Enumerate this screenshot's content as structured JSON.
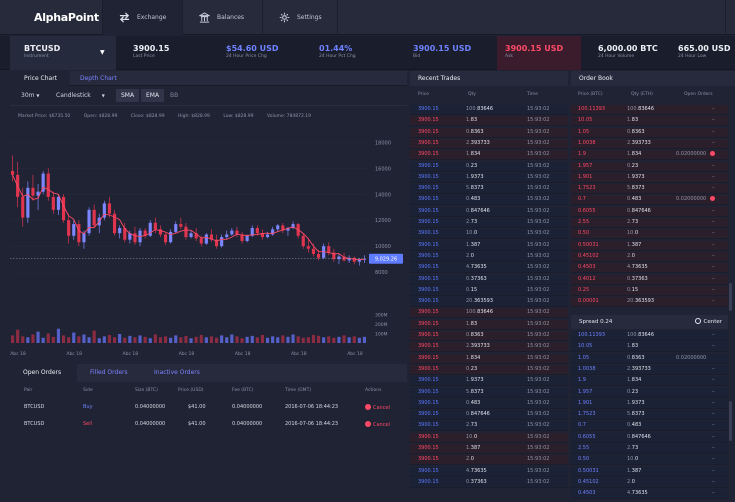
{
  "app": {
    "logo": "AlphaPoint"
  },
  "nav": {
    "tabs": [
      {
        "label": "Exchange",
        "icon": "exchange-icon",
        "active": true
      },
      {
        "label": "Balances",
        "icon": "bank-icon",
        "active": false
      },
      {
        "label": "Settings",
        "icon": "gear-icon",
        "active": false
      }
    ]
  },
  "ticker": {
    "instrument": {
      "value": "BTCUSD",
      "label": "Instrument"
    },
    "stats": [
      {
        "value": "3900.15",
        "label": "Last Price",
        "style": "plain"
      },
      {
        "value": "$54.60 USD",
        "label": "24 Hour Price Chg",
        "style": "blue"
      },
      {
        "value": "01.44%",
        "label": "24 Hour Pct Chg",
        "style": "blue"
      },
      {
        "value": "3900.15 USD",
        "label": "Bid",
        "style": "blue"
      },
      {
        "value": "3900.15 USD",
        "label": "Ask",
        "style": "red"
      },
      {
        "value": "6,000.00 BTC",
        "label": "24 Hour Volume",
        "style": "plain"
      },
      {
        "value": "665.00 USD",
        "label": "24 Hour Low",
        "style": "plain"
      }
    ]
  },
  "chart_panel": {
    "tabs": [
      "Price Chart",
      "Depth Chart"
    ],
    "interval": "30m",
    "chart_style": "Candlestick",
    "indicators": [
      "SMA",
      "EMA",
      "BB"
    ],
    "ohlc": {
      "market": "Market Price: $6735.50",
      "open": "Open: $828.99",
      "close": "Close: $828.99",
      "high": "High: $828.99",
      "low": "Low: $828.99",
      "volume": "Volume: 784872.19"
    }
  },
  "chart_data": {
    "type": "candlestick",
    "price_axis": {
      "ticks": [
        "18000",
        "16000",
        "14000",
        "12000",
        "10000",
        "8000"
      ],
      "values": [
        18000,
        16000,
        14000,
        12000,
        10000,
        8000
      ],
      "range": [
        6000,
        19500
      ]
    },
    "volume_axis": {
      "ticks": [
        "300M",
        "200M",
        "100M"
      ],
      "values": [
        300,
        200,
        100
      ],
      "range": [
        0,
        400
      ]
    },
    "x_tick_labels": [
      "Abc 18",
      "Abc 18",
      "Abc 18",
      "Abc 18",
      "Abc 18",
      "Abc 18",
      "Abc 18"
    ],
    "current_price": {
      "label": "9,029.26",
      "value": 9029.26
    },
    "candles": [
      [
        15800,
        17000,
        15000,
        15500
      ],
      [
        15500,
        16500,
        13000,
        13800
      ],
      [
        13800,
        14500,
        11500,
        12200
      ],
      [
        12200,
        15000,
        11800,
        14500
      ],
      [
        14500,
        15500,
        13500,
        13900
      ],
      [
        13900,
        14800,
        12800,
        14200
      ],
      [
        14200,
        15800,
        14000,
        15600
      ],
      [
        15600,
        16000,
        13500,
        13800
      ],
      [
        13800,
        14200,
        12500,
        12800
      ],
      [
        12800,
        14000,
        12400,
        13800
      ],
      [
        13800,
        14000,
        11800,
        12000
      ],
      [
        12000,
        12500,
        10200,
        10800
      ],
      [
        10800,
        12000,
        10500,
        11700
      ],
      [
        11700,
        12000,
        10000,
        10300
      ],
      [
        10300,
        11200,
        9800,
        11000
      ],
      [
        11000,
        13000,
        10800,
        12800
      ],
      [
        12800,
        13200,
        11400,
        11600
      ],
      [
        11600,
        12500,
        11000,
        12200
      ],
      [
        12200,
        13500,
        12000,
        13300
      ],
      [
        13300,
        13800,
        12200,
        12500
      ],
      [
        12500,
        12800,
        10800,
        11000
      ],
      [
        11000,
        11600,
        10600,
        11400
      ],
      [
        11400,
        11800,
        10300,
        10500
      ],
      [
        10500,
        11200,
        10200,
        11000
      ],
      [
        11000,
        11500,
        10100,
        10300
      ],
      [
        10300,
        11400,
        10000,
        11200
      ],
      [
        11200,
        11400,
        10600,
        10800
      ],
      [
        10800,
        12000,
        10700,
        11800
      ],
      [
        11800,
        12200,
        11000,
        11300
      ],
      [
        11300,
        11600,
        10700,
        10900
      ],
      [
        10900,
        11000,
        10100,
        10300
      ],
      [
        10300,
        11300,
        10200,
        11100
      ],
      [
        11100,
        11900,
        11000,
        11700
      ],
      [
        11700,
        12200,
        11300,
        11500
      ],
      [
        11500,
        11800,
        10500,
        10700
      ],
      [
        10700,
        11200,
        10600,
        11000
      ],
      [
        11000,
        11400,
        10400,
        10600
      ],
      [
        10600,
        10800,
        10000,
        10200
      ],
      [
        10200,
        11000,
        10100,
        10900
      ],
      [
        10900,
        11300,
        10300,
        10500
      ],
      [
        10500,
        10900,
        9800,
        10000
      ],
      [
        10000,
        10900,
        9900,
        10700
      ],
      [
        10700,
        11200,
        10500,
        10900
      ],
      [
        10900,
        11400,
        10800,
        11200
      ],
      [
        11200,
        11500,
        10700,
        10900
      ],
      [
        10900,
        11100,
        10200,
        10400
      ],
      [
        10400,
        10900,
        10300,
        10800
      ],
      [
        10800,
        11600,
        10700,
        11400
      ],
      [
        11400,
        11600,
        10800,
        11000
      ],
      [
        11000,
        11300,
        10500,
        10700
      ],
      [
        10700,
        11100,
        10600,
        10900
      ],
      [
        10900,
        11500,
        10800,
        11300
      ],
      [
        11300,
        11700,
        11100,
        11600
      ],
      [
        11600,
        11800,
        11000,
        11200
      ],
      [
        11200,
        11500,
        10800,
        11400
      ],
      [
        11400,
        11900,
        11300,
        11700
      ],
      [
        11700,
        11800,
        10600,
        10800
      ],
      [
        10800,
        11000,
        9800,
        10000
      ],
      [
        10000,
        10500,
        9500,
        9800
      ],
      [
        9800,
        10200,
        9200,
        9400
      ],
      [
        9400,
        9700,
        8900,
        9100
      ],
      [
        9100,
        10200,
        9000,
        10000
      ],
      [
        10000,
        10300,
        9300,
        9500
      ],
      [
        9500,
        9800,
        8800,
        9000
      ],
      [
        9000,
        9400,
        8600,
        9200
      ],
      [
        9200,
        9500,
        8800,
        8900
      ],
      [
        8900,
        9300,
        8700,
        9100
      ],
      [
        9100,
        9200,
        8600,
        8800
      ],
      [
        8800,
        9100,
        8500,
        9000
      ],
      [
        9000,
        9300,
        8700,
        9029
      ]
    ],
    "volumes": [
      80,
      140,
      70,
      60,
      90,
      120,
      55,
      100,
      65,
      150,
      80,
      60,
      110,
      70,
      90,
      60,
      130,
      50,
      70,
      85,
      60,
      95,
      55,
      75,
      60,
      80,
      65,
      50,
      90,
      60,
      70,
      55,
      80,
      60,
      75,
      50,
      65,
      85,
      60,
      70,
      55,
      80,
      60,
      90,
      70,
      50,
      65,
      75,
      60,
      85,
      55,
      70,
      60,
      80,
      65,
      90,
      70,
      55,
      60,
      85,
      75,
      60,
      70,
      55,
      65,
      80,
      60,
      70,
      55,
      65
    ]
  },
  "orders": {
    "tabs": [
      "Open Orders",
      "Filled Orders",
      "Inactive Orders"
    ],
    "columns": [
      "Pair",
      "Side",
      "Size (BTC)",
      "Price (USD)",
      "Fee (BTC)",
      "Time (GMT)",
      "Actions"
    ],
    "rows": [
      {
        "pair": "BTCUSD",
        "side": "Buy",
        "size": "0.04000000",
        "price": "$41.00",
        "fee": "0.04000000",
        "time": "2016-07-06 18:44:23",
        "action": "Cancel"
      },
      {
        "pair": "BTCUSD",
        "side": "Sell",
        "size": "0.04000000",
        "price": "$41.00",
        "fee": "0.04000000",
        "time": "2016-07-06 18:44:23",
        "action": "Cancel"
      }
    ]
  },
  "trades": {
    "title": "Recent Trades",
    "columns": [
      "Price",
      "Qty",
      "Time"
    ],
    "rows": [
      {
        "p": "3900.15",
        "s": "b",
        "q1": "100.",
        "q2": "83646",
        "t": "15:93:02"
      },
      {
        "p": "3900.15",
        "s": "s",
        "q1": "1.",
        "q2": "83",
        "t": "15:93:02"
      },
      {
        "p": "3900.15",
        "s": "s",
        "q1": "0.",
        "q2": "8363",
        "t": "15:93:02"
      },
      {
        "p": "3900.15",
        "s": "s",
        "q1": "2.",
        "q2": "393733",
        "t": "15:93:02"
      },
      {
        "p": "3900.15",
        "s": "s",
        "q1": "1.",
        "q2": "834",
        "t": "15:93:02"
      },
      {
        "p": "3900.15",
        "s": "b",
        "q1": "0.",
        "q2": "23",
        "t": "15:93:02"
      },
      {
        "p": "3900.15",
        "s": "b",
        "q1": "1.",
        "q2": "9373",
        "t": "15:93:02"
      },
      {
        "p": "3900.15",
        "s": "b",
        "q1": "5.",
        "q2": "8373",
        "t": "15:93:02"
      },
      {
        "p": "3900.15",
        "s": "b",
        "q1": "0.",
        "q2": "483",
        "t": "15:93:02"
      },
      {
        "p": "3900.15",
        "s": "b",
        "q1": "0.",
        "q2": "847646",
        "t": "15:93:02"
      },
      {
        "p": "3900.15",
        "s": "b",
        "q1": "2.",
        "q2": "73",
        "t": "15:93:02"
      },
      {
        "p": "3900.15",
        "s": "b",
        "q1": "10.",
        "q2": "0",
        "t": "15:93:02"
      },
      {
        "p": "3900.15",
        "s": "b",
        "q1": "1.",
        "q2": "387",
        "t": "15:93:02"
      },
      {
        "p": "3900.15",
        "s": "b",
        "q1": "2.",
        "q2": "0",
        "t": "15:93:02"
      },
      {
        "p": "3900.15",
        "s": "b",
        "q1": "4.",
        "q2": "73635",
        "t": "15:93:02"
      },
      {
        "p": "3900.15",
        "s": "b",
        "q1": "0.",
        "q2": "37363",
        "t": "15:93:02"
      },
      {
        "p": "3900.15",
        "s": "b",
        "q1": "0.",
        "q2": "15",
        "t": "15:93:02"
      },
      {
        "p": "3900.15",
        "s": "b",
        "q1": "20.",
        "q2": "363593",
        "t": "15:93:02"
      },
      {
        "p": "3900.15",
        "s": "s",
        "q1": "100.",
        "q2": "83646",
        "t": "15:93:02"
      },
      {
        "p": "3900.15",
        "s": "s",
        "q1": "1.",
        "q2": "83",
        "t": "15:93:02"
      },
      {
        "p": "3900.15",
        "s": "s",
        "q1": "0.",
        "q2": "8363",
        "t": "15:93:02"
      },
      {
        "p": "3900.15",
        "s": "s",
        "q1": "2.",
        "q2": "393733",
        "t": "15:93:02"
      },
      {
        "p": "3900.15",
        "s": "s",
        "q1": "1.",
        "q2": "834",
        "t": "15:93:02"
      },
      {
        "p": "3900.15",
        "s": "s",
        "q1": "0.",
        "q2": "23",
        "t": "15:93:02"
      },
      {
        "p": "3900.15",
        "s": "b",
        "q1": "1.",
        "q2": "9373",
        "t": "15:93:02"
      },
      {
        "p": "3900.15",
        "s": "b",
        "q1": "5.",
        "q2": "8373",
        "t": "15:93:02"
      },
      {
        "p": "3900.15",
        "s": "b",
        "q1": "0.",
        "q2": "483",
        "t": "15:93:02"
      },
      {
        "p": "3900.15",
        "s": "b",
        "q1": "0.",
        "q2": "847646",
        "t": "15:93:02"
      },
      {
        "p": "3900.15",
        "s": "b",
        "q1": "2.",
        "q2": "73",
        "t": "15:93:02"
      },
      {
        "p": "3900.15",
        "s": "s",
        "q1": "10.",
        "q2": "0",
        "t": "15:93:02"
      },
      {
        "p": "3900.15",
        "s": "s",
        "q1": "1.",
        "q2": "387",
        "t": "15:93:02"
      },
      {
        "p": "3900.15",
        "s": "s",
        "q1": "2.",
        "q2": "0",
        "t": "15:93:02"
      },
      {
        "p": "3900.15",
        "s": "b",
        "q1": "4.",
        "q2": "73635",
        "t": "15:93:02"
      },
      {
        "p": "3900.15",
        "s": "b",
        "q1": "0.",
        "q2": "37363",
        "t": "15:93:02"
      }
    ]
  },
  "book": {
    "title": "Order Book",
    "columns": [
      "Price (BTC)",
      "Qty (ETH)",
      "Open Orders"
    ],
    "asks": [
      {
        "p": "100.11393",
        "q1": "100.",
        "q2": "83646",
        "o": "–"
      },
      {
        "p": "10.05",
        "q1": "1.",
        "q2": "83",
        "o": "–"
      },
      {
        "p": "1.05",
        "q1": "0.",
        "q2": "8363",
        "o": "–"
      },
      {
        "p": "1.0038",
        "q1": "2.",
        "q2": "393733",
        "o": "–"
      },
      {
        "p": "1.9",
        "q1": "1.",
        "q2": "834",
        "o": "0.02000000",
        "x": true
      },
      {
        "p": "1.957",
        "q1": "0.",
        "q2": "23",
        "o": "–"
      },
      {
        "p": "1.901",
        "q1": "1.",
        "q2": "9373",
        "o": "–"
      },
      {
        "p": "1.7523",
        "q1": "5.",
        "q2": "8373",
        "o": "–"
      },
      {
        "p": "0.7",
        "q1": "0.",
        "q2": "483",
        "o": "0.02000000",
        "x": true
      },
      {
        "p": "0.6055",
        "q1": "0.",
        "q2": "847646",
        "o": "–"
      },
      {
        "p": "2.55",
        "q1": "2.",
        "q2": "73",
        "o": "–"
      },
      {
        "p": "0.50",
        "q1": "10.",
        "q2": "0",
        "o": "–"
      },
      {
        "p": "0.50031",
        "q1": "1.",
        "q2": "387",
        "o": "–"
      },
      {
        "p": "0.45102",
        "q1": "2.",
        "q2": "0",
        "o": "–"
      },
      {
        "p": "0.4503",
        "q1": "4.",
        "q2": "73635",
        "o": "–"
      },
      {
        "p": "0.4012",
        "q1": "0.",
        "q2": "37363",
        "o": "–"
      },
      {
        "p": "0.25",
        "q1": "0.",
        "q2": "15",
        "o": "–"
      },
      {
        "p": "0.00001",
        "q1": "20.",
        "q2": "363593",
        "o": "–"
      }
    ],
    "spread": "Spread 0.24",
    "center_label": "Center",
    "bids": [
      {
        "p": "100.11393",
        "q1": "100.",
        "q2": "83646",
        "o": "–"
      },
      {
        "p": "10.05",
        "q1": "1.",
        "q2": "83",
        "o": "–"
      },
      {
        "p": "1.05",
        "q1": "0.",
        "q2": "8363",
        "o": "0.02000000"
      },
      {
        "p": "1.0038",
        "q1": "2.",
        "q2": "393733",
        "o": "–"
      },
      {
        "p": "1.9",
        "q1": "1.",
        "q2": "834",
        "o": "–"
      },
      {
        "p": "1.957",
        "q1": "0.",
        "q2": "23",
        "o": "–"
      },
      {
        "p": "1.901",
        "q1": "1.",
        "q2": "9373",
        "o": "–"
      },
      {
        "p": "1.7523",
        "q1": "5.",
        "q2": "8373",
        "o": "–"
      },
      {
        "p": "0.7",
        "q1": "0.",
        "q2": "483",
        "o": "–"
      },
      {
        "p": "0.6055",
        "q1": "0.",
        "q2": "847646",
        "o": "–"
      },
      {
        "p": "2.55",
        "q1": "2.",
        "q2": "73",
        "o": "–"
      },
      {
        "p": "0.50",
        "q1": "10.",
        "q2": "0",
        "o": "–"
      },
      {
        "p": "0.50031",
        "q1": "1.",
        "q2": "387",
        "o": "–"
      },
      {
        "p": "0.45102",
        "q1": "2.",
        "q2": "0",
        "o": "–"
      },
      {
        "p": "0.4503",
        "q1": "4.",
        "q2": "73635",
        "o": "–"
      }
    ]
  },
  "colors": {
    "bg": "#1f2333",
    "panel": "#262a3c",
    "up": "#7c86ff",
    "down": "#e0344f",
    "accent": "#6f82ff"
  }
}
